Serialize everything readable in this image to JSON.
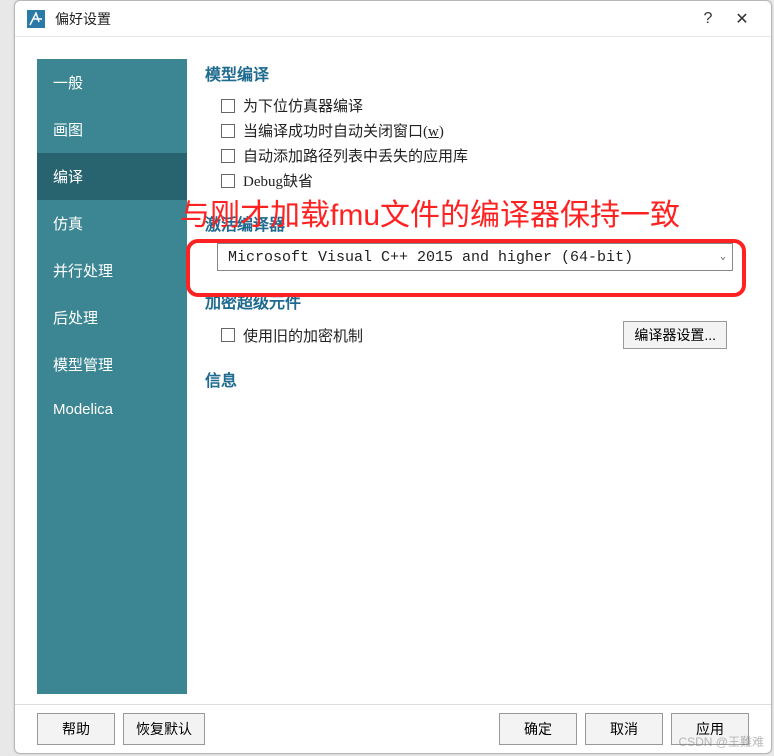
{
  "titlebar": {
    "title": "偏好设置"
  },
  "sidebar": {
    "items": [
      {
        "label": "一般"
      },
      {
        "label": "画图"
      },
      {
        "label": "编译"
      },
      {
        "label": "仿真"
      },
      {
        "label": "并行处理"
      },
      {
        "label": "后处理"
      },
      {
        "label": "模型管理"
      },
      {
        "label": "Modelica"
      }
    ],
    "active_index": 2
  },
  "sections": {
    "model_compile": {
      "header": "模型编译",
      "opts": {
        "compile_for_sub": "为下位仿真器编译",
        "auto_close_prefix": "当编译成功时自动关闭窗口(",
        "auto_close_key": "w",
        "auto_close_suffix": ")",
        "auto_add_lib": "自动添加路径列表中丢失的应用库",
        "debug_default": "Debug缺省"
      }
    },
    "active_compiler": {
      "header": "激活编译器",
      "selected": "Microsoft Visual C++ 2015 and higher (64-bit)"
    },
    "encrypt": {
      "header": "加密超级元件",
      "use_old": "使用旧的加密机制",
      "compiler_settings_btn": "编译器设置..."
    },
    "info": {
      "header": "信息"
    }
  },
  "annotation": "与刚才加载fmu文件的编译器保持一致",
  "buttons": {
    "help": "帮助",
    "restore": "恢复默认",
    "ok": "确定",
    "cancel": "取消",
    "apply": "应用"
  },
  "watermark": "CSDN @王難难"
}
